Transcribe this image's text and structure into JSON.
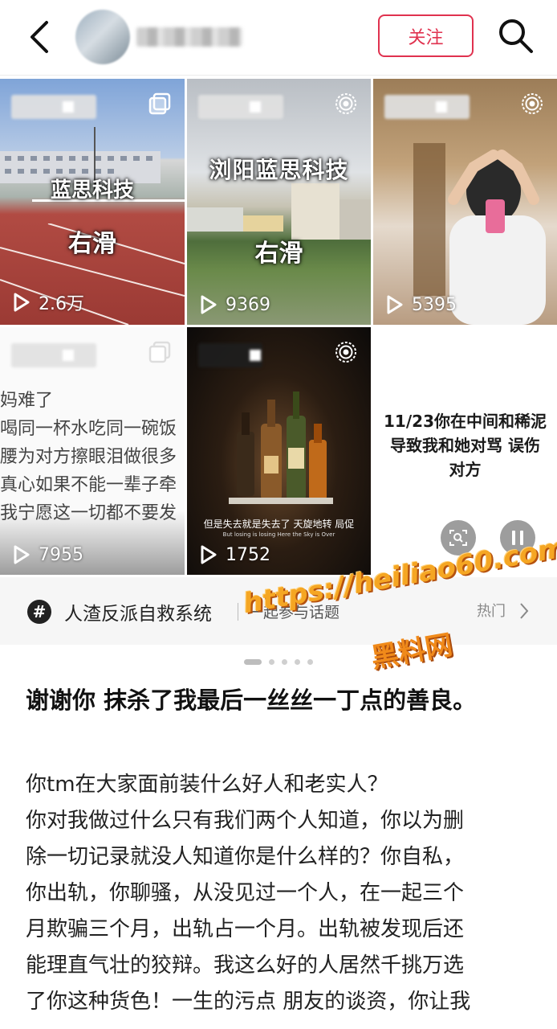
{
  "header": {
    "follow_label": "关注",
    "icons": [
      "back-arrow-icon",
      "search-icon"
    ]
  },
  "tiles": [
    {
      "id": "t1",
      "overlay_top": "蓝思科技",
      "overlay_bottom": "右滑",
      "views": "2.6万",
      "corner_icon": "gallery-icon"
    },
    {
      "id": "t2",
      "overlay_top": "浏阳蓝思科技",
      "overlay_bottom": "右滑",
      "views": "9369",
      "corner_icon": "live-icon"
    },
    {
      "id": "t3",
      "views": "5395",
      "corner_icon": "live-icon"
    },
    {
      "id": "t4",
      "lines": [
        "妈难了",
        " 喝同一杯水吃同一碗饭",
        "腰为对方擦眼泪做很多",
        "真心如果不能一辈子牵",
        "我宁愿这一切都不要发"
      ],
      "views": "7955",
      "corner_icon": "gallery-icon"
    },
    {
      "id": "t5",
      "caption": "但是失去就是失去了  天旋地转  局促",
      "caption_small": "But losing is losing Here the Sky is Over",
      "views": "1752",
      "corner_icon": "live-icon"
    },
    {
      "id": "t6",
      "text_lines": [
        "11/23你在中间和稀泥",
        "导致我和她对骂 误伤",
        "对方"
      ],
      "buttons": [
        "lens-icon",
        "pause-icon"
      ]
    }
  ],
  "topic": {
    "name": "人渣反派自救系统",
    "join": "一起参与话题",
    "more": "热门"
  },
  "watermark": {
    "url": "https://heiliao60.com",
    "name": "黑料网"
  },
  "carousel": {
    "count": 6,
    "active": 0
  },
  "post": {
    "title": "谢谢你 抹杀了我最后一丝丝一丁点的善良。",
    "body_lines": [
      "你tm在大家面前装什么好人和老实人？",
      "你对我做过什么只有我们两个人知道，你以为删",
      "除一切记录就没人知道你是什么样的？你自私，",
      "你出轨，你聊骚，从没见过一个人，在一起三个",
      "月欺骗三个月，出轨占一个月。出轨被发现后还",
      "能理直气壮的狡辩。我这么好的人居然千挑万选",
      "了你这种货色！一生的污点 朋友的谈资，你让我"
    ]
  }
}
